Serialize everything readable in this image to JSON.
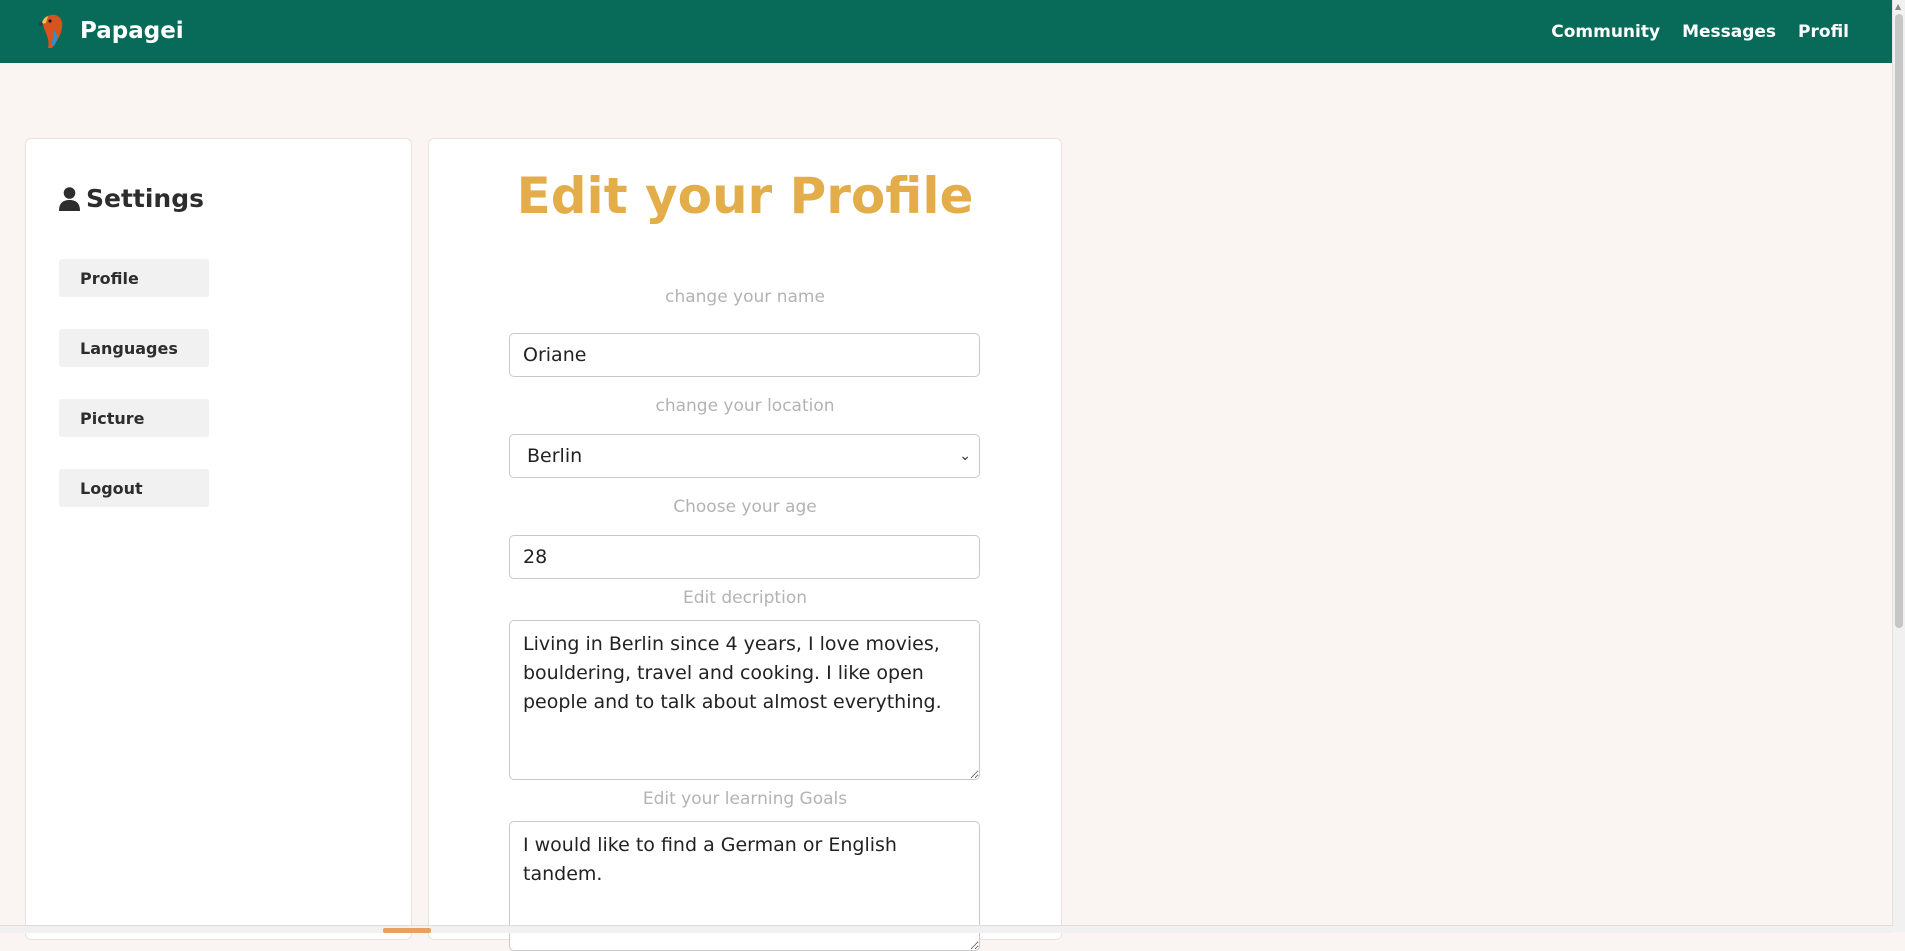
{
  "header": {
    "brand": "Papagei",
    "nav": [
      "Community",
      "Messages",
      "Profil"
    ]
  },
  "sidebar": {
    "title": "Settings",
    "items": [
      "Profile",
      "Languages",
      "Picture",
      "Logout"
    ]
  },
  "form": {
    "title": "Edit your Profile",
    "name_label": "change your name",
    "name_value": "Oriane",
    "location_label": "change your location",
    "location_value": "Berlin",
    "age_label": "Choose your age",
    "age_value": "28",
    "description_label": "Edit decription",
    "description_value": "Living in Berlin since 4 years, I love movies, bouldering, travel and cooking. I like open people and to talk about almost everything.",
    "goals_label": "Edit your learning Goals",
    "goals_value": "I would like to find a German or English tandem."
  },
  "colors": {
    "topbar": "#086b5a",
    "title_accent": "#e3ae4a",
    "background": "#faf5f3"
  },
  "icons": {
    "brand": "parrot-icon",
    "settings": "user-icon"
  }
}
